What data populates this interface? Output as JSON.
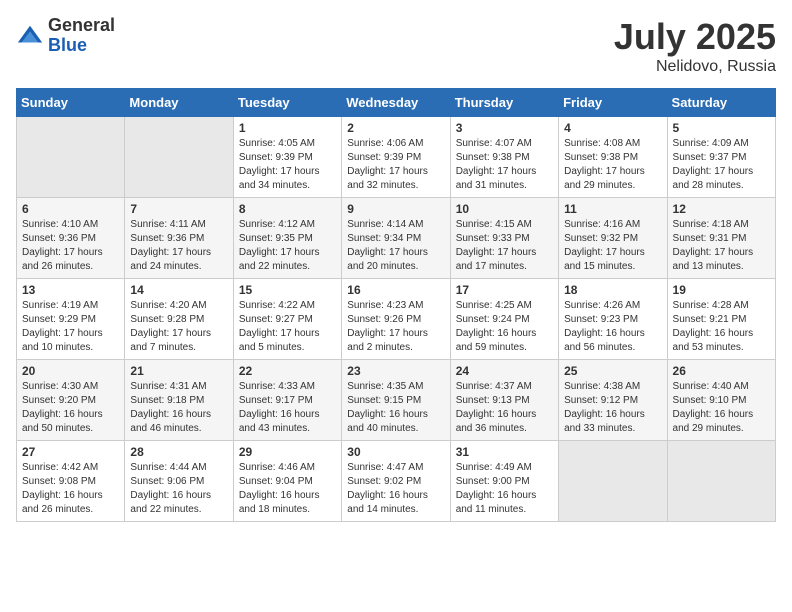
{
  "logo": {
    "general": "General",
    "blue": "Blue"
  },
  "title": {
    "month_year": "July 2025",
    "location": "Nelidovo, Russia"
  },
  "days_of_week": [
    "Sunday",
    "Monday",
    "Tuesday",
    "Wednesday",
    "Thursday",
    "Friday",
    "Saturday"
  ],
  "weeks": [
    [
      {
        "day": "",
        "info": ""
      },
      {
        "day": "",
        "info": ""
      },
      {
        "day": "1",
        "info": "Sunrise: 4:05 AM\nSunset: 9:39 PM\nDaylight: 17 hours and 34 minutes."
      },
      {
        "day": "2",
        "info": "Sunrise: 4:06 AM\nSunset: 9:39 PM\nDaylight: 17 hours and 32 minutes."
      },
      {
        "day": "3",
        "info": "Sunrise: 4:07 AM\nSunset: 9:38 PM\nDaylight: 17 hours and 31 minutes."
      },
      {
        "day": "4",
        "info": "Sunrise: 4:08 AM\nSunset: 9:38 PM\nDaylight: 17 hours and 29 minutes."
      },
      {
        "day": "5",
        "info": "Sunrise: 4:09 AM\nSunset: 9:37 PM\nDaylight: 17 hours and 28 minutes."
      }
    ],
    [
      {
        "day": "6",
        "info": "Sunrise: 4:10 AM\nSunset: 9:36 PM\nDaylight: 17 hours and 26 minutes."
      },
      {
        "day": "7",
        "info": "Sunrise: 4:11 AM\nSunset: 9:36 PM\nDaylight: 17 hours and 24 minutes."
      },
      {
        "day": "8",
        "info": "Sunrise: 4:12 AM\nSunset: 9:35 PM\nDaylight: 17 hours and 22 minutes."
      },
      {
        "day": "9",
        "info": "Sunrise: 4:14 AM\nSunset: 9:34 PM\nDaylight: 17 hours and 20 minutes."
      },
      {
        "day": "10",
        "info": "Sunrise: 4:15 AM\nSunset: 9:33 PM\nDaylight: 17 hours and 17 minutes."
      },
      {
        "day": "11",
        "info": "Sunrise: 4:16 AM\nSunset: 9:32 PM\nDaylight: 17 hours and 15 minutes."
      },
      {
        "day": "12",
        "info": "Sunrise: 4:18 AM\nSunset: 9:31 PM\nDaylight: 17 hours and 13 minutes."
      }
    ],
    [
      {
        "day": "13",
        "info": "Sunrise: 4:19 AM\nSunset: 9:29 PM\nDaylight: 17 hours and 10 minutes."
      },
      {
        "day": "14",
        "info": "Sunrise: 4:20 AM\nSunset: 9:28 PM\nDaylight: 17 hours and 7 minutes."
      },
      {
        "day": "15",
        "info": "Sunrise: 4:22 AM\nSunset: 9:27 PM\nDaylight: 17 hours and 5 minutes."
      },
      {
        "day": "16",
        "info": "Sunrise: 4:23 AM\nSunset: 9:26 PM\nDaylight: 17 hours and 2 minutes."
      },
      {
        "day": "17",
        "info": "Sunrise: 4:25 AM\nSunset: 9:24 PM\nDaylight: 16 hours and 59 minutes."
      },
      {
        "day": "18",
        "info": "Sunrise: 4:26 AM\nSunset: 9:23 PM\nDaylight: 16 hours and 56 minutes."
      },
      {
        "day": "19",
        "info": "Sunrise: 4:28 AM\nSunset: 9:21 PM\nDaylight: 16 hours and 53 minutes."
      }
    ],
    [
      {
        "day": "20",
        "info": "Sunrise: 4:30 AM\nSunset: 9:20 PM\nDaylight: 16 hours and 50 minutes."
      },
      {
        "day": "21",
        "info": "Sunrise: 4:31 AM\nSunset: 9:18 PM\nDaylight: 16 hours and 46 minutes."
      },
      {
        "day": "22",
        "info": "Sunrise: 4:33 AM\nSunset: 9:17 PM\nDaylight: 16 hours and 43 minutes."
      },
      {
        "day": "23",
        "info": "Sunrise: 4:35 AM\nSunset: 9:15 PM\nDaylight: 16 hours and 40 minutes."
      },
      {
        "day": "24",
        "info": "Sunrise: 4:37 AM\nSunset: 9:13 PM\nDaylight: 16 hours and 36 minutes."
      },
      {
        "day": "25",
        "info": "Sunrise: 4:38 AM\nSunset: 9:12 PM\nDaylight: 16 hours and 33 minutes."
      },
      {
        "day": "26",
        "info": "Sunrise: 4:40 AM\nSunset: 9:10 PM\nDaylight: 16 hours and 29 minutes."
      }
    ],
    [
      {
        "day": "27",
        "info": "Sunrise: 4:42 AM\nSunset: 9:08 PM\nDaylight: 16 hours and 26 minutes."
      },
      {
        "day": "28",
        "info": "Sunrise: 4:44 AM\nSunset: 9:06 PM\nDaylight: 16 hours and 22 minutes."
      },
      {
        "day": "29",
        "info": "Sunrise: 4:46 AM\nSunset: 9:04 PM\nDaylight: 16 hours and 18 minutes."
      },
      {
        "day": "30",
        "info": "Sunrise: 4:47 AM\nSunset: 9:02 PM\nDaylight: 16 hours and 14 minutes."
      },
      {
        "day": "31",
        "info": "Sunrise: 4:49 AM\nSunset: 9:00 PM\nDaylight: 16 hours and 11 minutes."
      },
      {
        "day": "",
        "info": ""
      },
      {
        "day": "",
        "info": ""
      }
    ]
  ]
}
